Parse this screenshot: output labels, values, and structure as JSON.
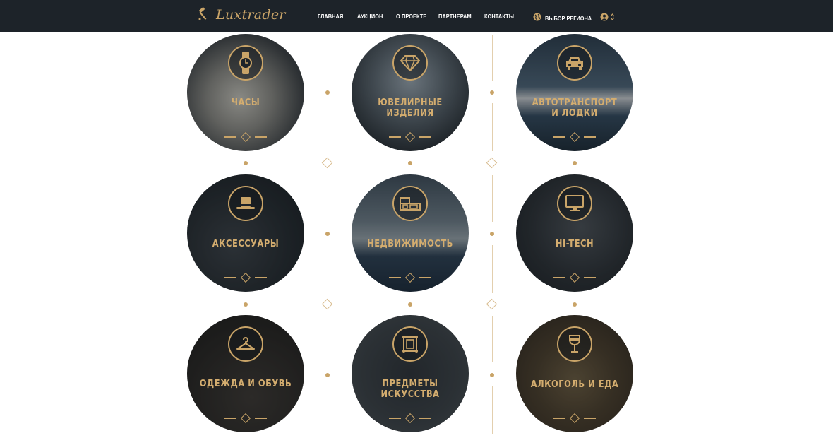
{
  "header": {
    "logo_text": "Luxtrader",
    "nav": [
      "ГЛАВНАЯ",
      "АУКЦИОН",
      "О ПРОЕКТЕ",
      "ПАРТНЕРАМ",
      "КОНТАКТЫ"
    ],
    "region_label": "ВЫБОР РЕГИОНА"
  },
  "categories": [
    {
      "label": "ЧАСЫ",
      "icon": "watch-icon"
    },
    {
      "label": "ЮВЕЛИРНЫЕ ИЗДЕЛИЯ",
      "icon": "diamond-icon"
    },
    {
      "label": "АВТОТРАНСПОРТ И ЛОДКИ",
      "icon": "car-icon"
    },
    {
      "label": "АКСЕССУАРЫ",
      "icon": "hat-icon"
    },
    {
      "label": "НЕДВИЖИМОСТЬ",
      "icon": "building-icon"
    },
    {
      "label": "HI-TECH",
      "icon": "monitor-icon"
    },
    {
      "label": "ОДЕЖДА И ОБУВЬ",
      "icon": "hanger-icon"
    },
    {
      "label": "ПРЕДМЕТЫ ИСКУССТВА",
      "icon": "frame-icon"
    },
    {
      "label": "АЛКОГОЛЬ И ЕДА",
      "icon": "wine-glass-icon"
    }
  ],
  "colors": {
    "header_bg": "#1d2329",
    "accent_gold": "#c9a468",
    "page_bg": "#ffffff"
  }
}
